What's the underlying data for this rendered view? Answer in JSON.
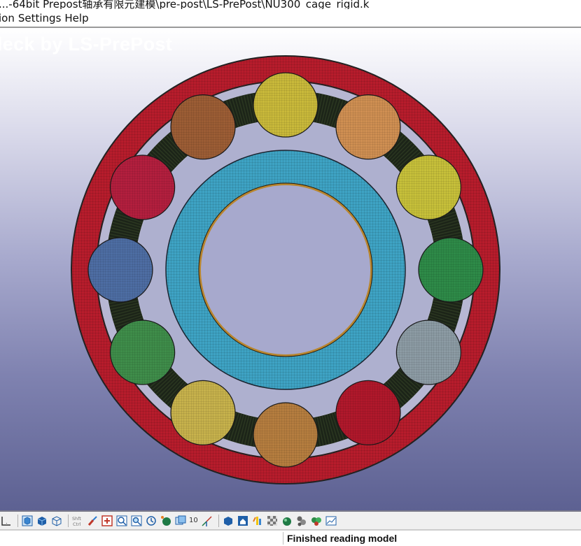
{
  "window": {
    "title": "...-64bit Prepost轴承有限元建模\\pre-post\\LS-PrePost\\NU300_cage_rigid.k"
  },
  "menubar": {
    "items": [
      {
        "label": "ion"
      },
      {
        "label": "Settings"
      },
      {
        "label": "Help"
      }
    ]
  },
  "viewport": {
    "watermark": "leck by LS-PrePost",
    "colors": {
      "outer_ring": "#b71c2c",
      "inner_ring": "#3ea3c4",
      "cage": "#1c2418",
      "background_top": "#ffffff",
      "background_bottom": "#5d6192"
    },
    "rollers": [
      {
        "name": "roller-yellow-top",
        "color": "#c9b93a"
      },
      {
        "name": "roller-tan-upper-right",
        "color": "#cf8f52"
      },
      {
        "name": "roller-yellow-right-upper",
        "color": "#c7c03a"
      },
      {
        "name": "roller-green-right",
        "color": "#2e8a48"
      },
      {
        "name": "roller-grey-right-lower",
        "color": "#8c9ba4"
      },
      {
        "name": "roller-red-lower-right",
        "color": "#b0182b"
      },
      {
        "name": "roller-tan-bottom",
        "color": "#b57d3f"
      },
      {
        "name": "roller-yellow-lower-left",
        "color": "#c7b24c"
      },
      {
        "name": "roller-green-left-lower",
        "color": "#3f8d4a"
      },
      {
        "name": "roller-blue-left",
        "color": "#4d6da3"
      },
      {
        "name": "roller-crimson-left-upper",
        "color": "#b31f3e"
      },
      {
        "name": "roller-brown-upper-left",
        "color": "#9c5d35"
      }
    ]
  },
  "toolbar": {
    "shift_ctrl_label": "Shft\nCtrl",
    "count_label": "10",
    "icons": [
      "view-axis-icon",
      "solid-cube-icon",
      "shaded-cube-icon",
      "wireframe-cube-icon",
      "shift-ctrl-icon",
      "paint-brush-icon",
      "add-box-icon",
      "zoom-in-icon",
      "zoom-box-icon",
      "rotate-icon",
      "sphere-icon",
      "copy-view-icon",
      "axis-triad-icon",
      "cube-view-icon",
      "home-icon",
      "fringe-icon",
      "checker-icon",
      "ball-icon",
      "settings-gears-icon",
      "multi-gear-icon",
      "plot-window-icon"
    ]
  },
  "statusbar": {
    "message": "Finished reading model"
  }
}
